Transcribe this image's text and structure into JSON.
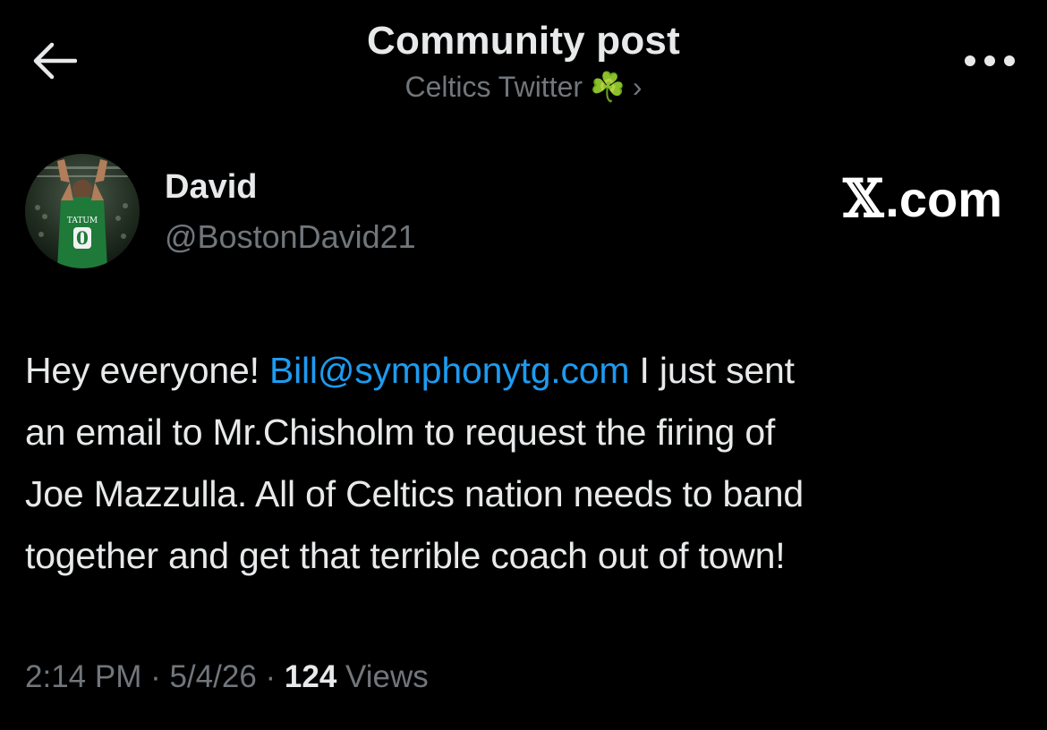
{
  "header": {
    "title": "Community post",
    "community_name": "Celtics Twitter",
    "community_emoji": "☘️",
    "chevron": "›"
  },
  "author": {
    "name": "David",
    "handle": "@BostonDavid21",
    "avatar_jersey_name": "TATUM",
    "avatar_jersey_number": "0"
  },
  "watermark": {
    "x": "𝕏",
    "text": ".com"
  },
  "post": {
    "line1_before": "Hey everyone! ",
    "email": "Bill@symphonytg.com",
    "line1_after": " I just sent",
    "line2": "an email to Mr.Chisholm to request the firing of",
    "line3": "Joe Mazzulla. All of Celtics nation needs to band",
    "line4": "together and get that terrible coach out of town!"
  },
  "meta": {
    "time": "2:14 PM",
    "sep1": " · ",
    "date": "5/4/26",
    "sep2": " · ",
    "views_count": "124",
    "views_label": " Views"
  },
  "icons": {
    "back": "back-arrow-icon",
    "more": "more-dots-icon"
  },
  "colors": {
    "background": "#000000",
    "primary_text": "#e7e9ea",
    "secondary_text": "#71767b",
    "link": "#1d9bf0",
    "celtics_green": "#007a33"
  }
}
